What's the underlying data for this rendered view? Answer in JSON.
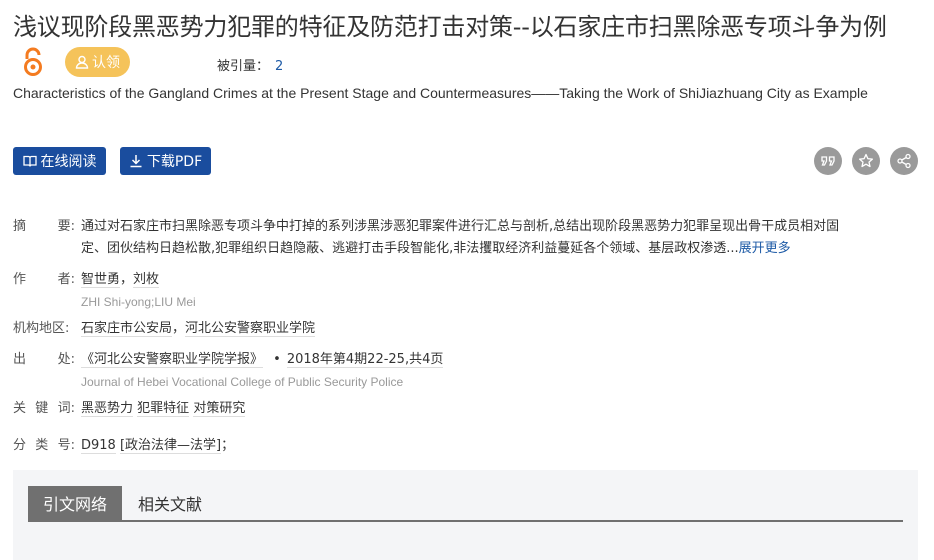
{
  "paper": {
    "title": "浅议现阶段黑恶势力犯罪的特征及防范打击对策--以石家庄市扫黑除恶专项斗争为例",
    "badge_label": "认领",
    "cite_label": "被引量：",
    "cite_count": "2",
    "en_title": "Characteristics of the Gangland Crimes at the Present Stage and Countermeasures——Taking the Work of ShiJiazhuang City as Example"
  },
  "actions": {
    "read_online": "在线阅读",
    "download_pdf": "下载PDF",
    "icons": [
      "quote-icon",
      "star-icon",
      "share-icon"
    ]
  },
  "meta": {
    "abstract_label": [
      "摘",
      "要:"
    ],
    "abstract_line1": "通过对石家庄市扫黑除恶专项斗争中打掉的系列涉黑涉恶犯罪案件进行汇总与剖析,总结出现阶段黑恶势力犯罪呈现出骨干成员相对固",
    "abstract_line2": "定、团伙结构日趋松散,犯罪组织日趋隐蔽、逃避打击手段智能化,非法攫取经济利益蔓延各个领域、基层政权渗透...",
    "abstract_more": "展开更多",
    "author_label": [
      "作",
      "者:"
    ],
    "author_1": "智世勇",
    "author_2": "刘枚",
    "author_en": "ZHI Shi-yong;LIU Mei",
    "inst_label": "机构地区:",
    "inst_1": "石家庄市公安局",
    "inst_2": "河北公安警察职业学院",
    "source_label": [
      "出",
      "处:"
    ],
    "source_journal": "《河北公安警察职业学院学报》",
    "source_issue": "2018年第4期22-25,共4页",
    "source_en": "Journal of Hebei Vocational College of Public Security Police",
    "kw_label": [
      "关",
      "键",
      "词:"
    ],
    "kw_1": "黑恶势力",
    "kw_2": "犯罪特征",
    "kw_3": "对策研究",
    "cls_label": [
      "分",
      "类",
      "号:"
    ],
    "cls_code": "D918",
    "cls_desc": "[政治法律—法学]",
    "cls_end": "；"
  },
  "tabs": {
    "active": "引文网络",
    "inactive": "相关文献"
  },
  "colors": {
    "primary": "#1a4d9e",
    "badge": "#f5c35a",
    "oa": "#f47b20",
    "link": "#1d5aa6"
  }
}
